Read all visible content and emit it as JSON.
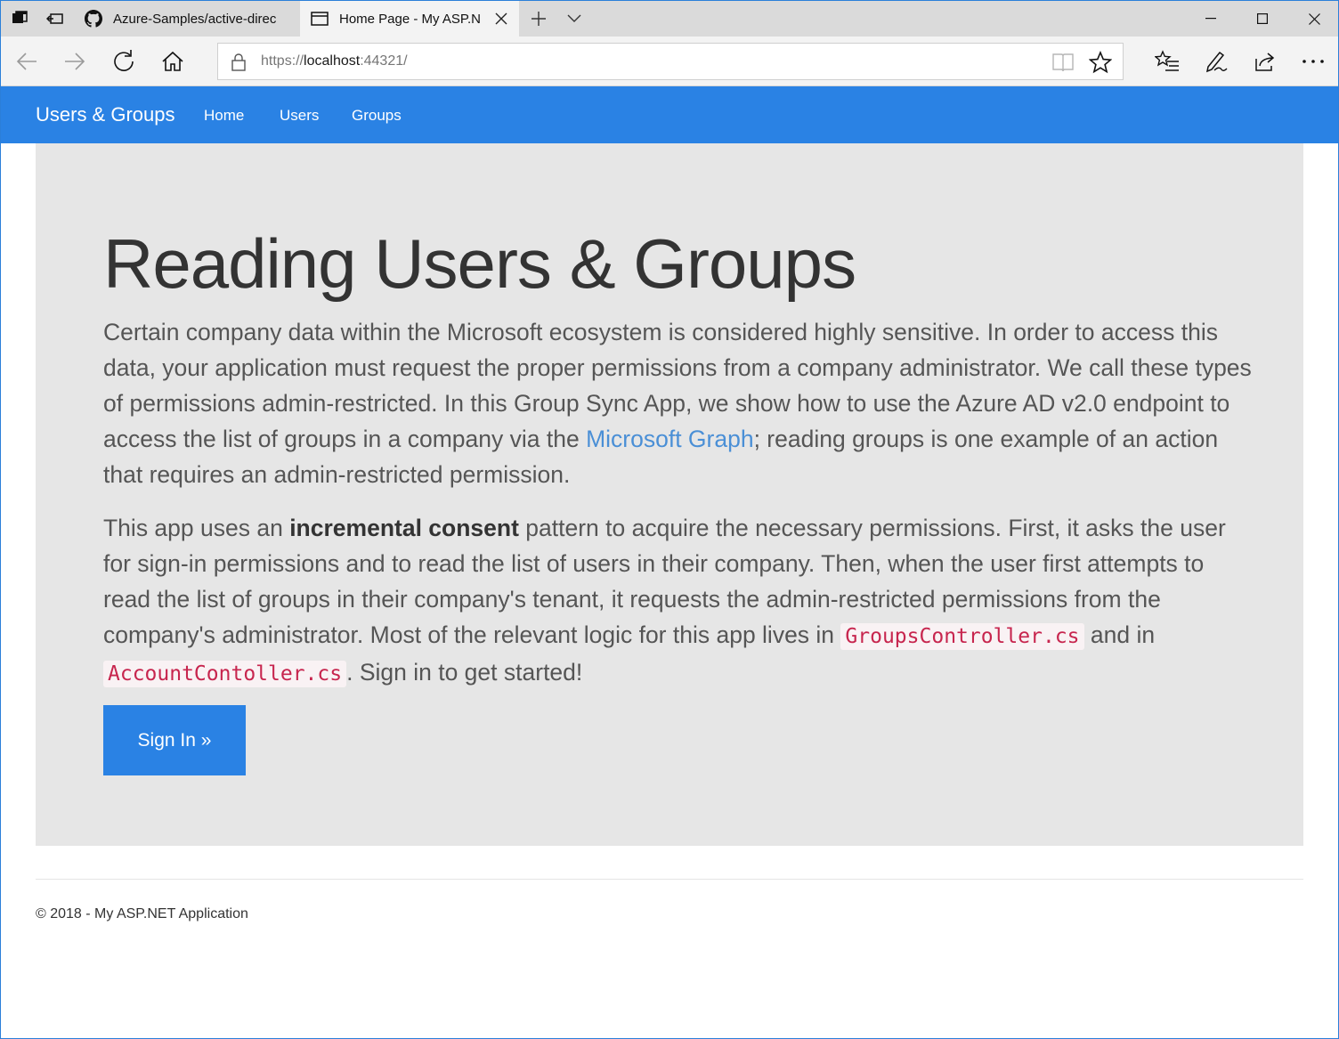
{
  "browser": {
    "tabs": [
      {
        "title": "Azure-Samples/active-direc",
        "icon": "github-icon",
        "active": false
      },
      {
        "title": "Home Page - My ASP.N",
        "icon": "page-icon",
        "active": true
      }
    ],
    "url_scheme": "https://",
    "url_host": "localhost",
    "url_rest": ":44321/"
  },
  "navbar": {
    "brand": "Users & Groups",
    "links": [
      "Home",
      "Users",
      "Groups"
    ]
  },
  "jumbotron": {
    "heading": "Reading Users & Groups",
    "p1_a": "Certain company data within the Microsoft ecosystem is considered highly sensitive. In order to access this data, your application must request the proper permissions from a company administrator. We call these types of permissions admin-restricted. In this Group Sync App, we show how to use the Azure AD v2.0 endpoint to access the list of groups in a company via the ",
    "p1_link": "Microsoft Graph",
    "p1_b": "; reading groups is one example of an action that requires an admin-restricted permission.",
    "p2_a": "This app uses an ",
    "p2_strong": "incremental consent",
    "p2_b": " pattern to acquire the necessary permissions. First, it asks the user for sign-in permissions and to read the list of users in their company. Then, when the user first attempts to read the list of groups in their company's tenant, it requests the admin-restricted permissions from the company's administrator. Most of the relevant logic for this app lives in ",
    "p2_code1": "GroupsController.cs",
    "p2_c": " and in ",
    "p2_code2": "AccountContoller.cs",
    "p2_d": ". Sign in to get started!",
    "button": "Sign In »"
  },
  "footer": {
    "text": "© 2018 - My ASP.NET Application"
  },
  "colors": {
    "navbar": "#2a82e4",
    "jumbotron": "#e6e6e6",
    "link": "#4a8fd6",
    "code": "#c7254e"
  }
}
